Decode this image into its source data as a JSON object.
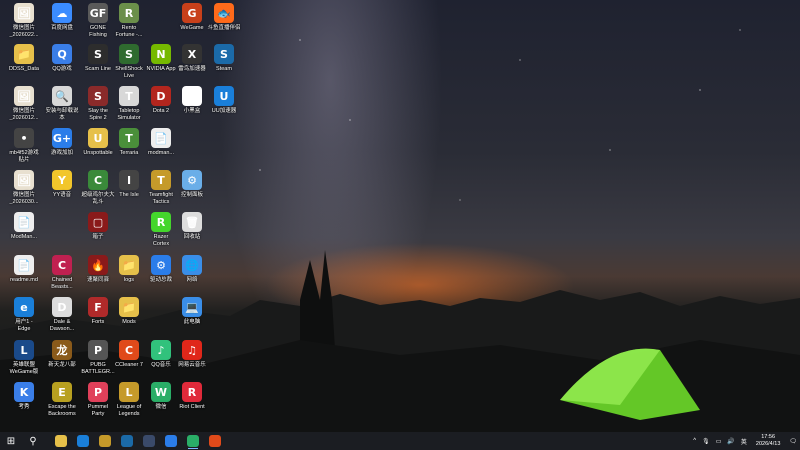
{
  "desktop": {
    "icons": [
      {
        "label": "微信图片\n_2026022...",
        "glyph": "🖼",
        "color": "#e8e0d0"
      },
      {
        "label": "百度网盘",
        "glyph": "☁",
        "color": "#3b8cff"
      },
      {
        "label": "GONE\nFishing",
        "glyph": "GF",
        "color": "#5a5a5a"
      },
      {
        "label": "Rento\nFortune -...",
        "glyph": "R",
        "color": "#6b8f4a"
      },
      {
        "label": "WeGame",
        "glyph": "G",
        "color": "#c8401a"
      },
      {
        "label": "斗鱼直播伴侣",
        "glyph": "🐟",
        "color": "#ff6a1a"
      },
      {
        "label": "DDSS_Data",
        "glyph": "📁",
        "color": "#e6c04a"
      },
      {
        "label": "QQ游戏",
        "glyph": "Q",
        "color": "#3a7ee8"
      },
      {
        "label": "Scam Line",
        "glyph": "S",
        "color": "#2d2d2d"
      },
      {
        "label": "ShellShock\nLive",
        "glyph": "S",
        "color": "#2f6b2f"
      },
      {
        "label": "NVIDIA App",
        "glyph": "N",
        "color": "#76b900"
      },
      {
        "label": "雷鸟加速器",
        "glyph": "X",
        "color": "#333"
      },
      {
        "label": "Steam",
        "glyph": "S",
        "color": "#1b6aa8"
      },
      {
        "label": "微信图片\n_2026012...",
        "glyph": "🖼",
        "color": "#e8e0d0"
      },
      {
        "label": "安装与卸载说\n本",
        "glyph": "🔍",
        "color": "#d8d8d8"
      },
      {
        "label": "Slay the\nSpire 2",
        "glyph": "S",
        "color": "#8a2a2a"
      },
      {
        "label": "Tabletop\nSimulator",
        "glyph": "T",
        "color": "#d8d8d8"
      },
      {
        "label": "Dota 2",
        "glyph": "D",
        "color": "#b3261e"
      },
      {
        "label": "小黑盒",
        "glyph": "H",
        "color": "#fff"
      },
      {
        "label": "UU加速器",
        "glyph": "U",
        "color": "#1a7fd9"
      },
      {
        "label": "mb4f52游戏\n贴片",
        "glyph": "•",
        "color": "#444"
      },
      {
        "label": "游戏加加",
        "glyph": "G+",
        "color": "#2b7de9"
      },
      {
        "label": "Unspottable",
        "glyph": "U",
        "color": "#e6c04a"
      },
      {
        "label": "Terraria",
        "glyph": "T",
        "color": "#4a8f3a"
      },
      {
        "label": "modman...",
        "glyph": "📄",
        "color": "#eee"
      },
      {
        "label": "微信图片\n_2026030...",
        "glyph": "🖼",
        "color": "#e8e0d0"
      },
      {
        "label": "YY语音",
        "glyph": "Y",
        "color": "#f2c62b"
      },
      {
        "label": "超级鸡尔夫大\n乱斗",
        "glyph": "C",
        "color": "#3a8a3a"
      },
      {
        "label": "The Isle",
        "glyph": "I",
        "color": "#444"
      },
      {
        "label": "Teamfight\nTactics",
        "glyph": "T",
        "color": "#c59a2a"
      },
      {
        "label": "控制面板",
        "glyph": "⚙",
        "color": "#6aaee8"
      },
      {
        "label": "ModMan...",
        "glyph": "📄",
        "color": "#eee"
      },
      {
        "label": "箱子",
        "glyph": "▢",
        "color": "#8a1a1a"
      },
      {
        "label": "Razer\nCortex",
        "glyph": "R",
        "color": "#44d62c"
      },
      {
        "label": "回收站",
        "glyph": "🗑",
        "color": "#ddd"
      },
      {
        "label": "readme.md",
        "glyph": "📄",
        "color": "#eee"
      },
      {
        "label": "Chained\nBeasts...",
        "glyph": "C",
        "color": "#c02050"
      },
      {
        "label": "速聚同驿",
        "glyph": "🔥",
        "color": "#8a1a1a"
      },
      {
        "label": "logs",
        "glyph": "📁",
        "color": "#e6c04a"
      },
      {
        "label": "驱动总裁",
        "glyph": "⚙",
        "color": "#2b7de9"
      },
      {
        "label": "网络",
        "glyph": "🌐",
        "color": "#3a8ee8"
      },
      {
        "label": "用户1 -\nEdge",
        "glyph": "e",
        "color": "#1a7fd9"
      },
      {
        "label": "Dale &\nDawson...",
        "glyph": "D",
        "color": "#ddd"
      },
      {
        "label": "Forts",
        "glyph": "F",
        "color": "#b02a2a"
      },
      {
        "label": "Mods",
        "glyph": "📁",
        "color": "#e6c04a"
      },
      {
        "label": "此电脑",
        "glyph": "💻",
        "color": "#3a8ee8"
      },
      {
        "label": "英雄联盟\nWeGame版",
        "glyph": "L",
        "color": "#1a4a8a"
      },
      {
        "label": "新天龙八部",
        "glyph": "龙",
        "color": "#8a5a1a"
      },
      {
        "label": "PUBG\nBATTLEGR...",
        "glyph": "P",
        "color": "#555"
      },
      {
        "label": "CCleaner 7",
        "glyph": "C",
        "color": "#e04a1a"
      },
      {
        "label": "QQ音乐",
        "glyph": "♪",
        "color": "#31c27c"
      },
      {
        "label": "网易云音乐",
        "glyph": "♫",
        "color": "#e0271a"
      },
      {
        "label": "考秀",
        "glyph": "K",
        "color": "#3a7ee8"
      },
      {
        "label": "Escape the\nBackrooms",
        "glyph": "E",
        "color": "#b8a020"
      },
      {
        "label": "Pummel\nParty",
        "glyph": "P",
        "color": "#e0405a"
      },
      {
        "label": "League of\nLegends",
        "glyph": "L",
        "color": "#c59a2a"
      },
      {
        "label": "微信",
        "glyph": "W",
        "color": "#2aae67"
      },
      {
        "label": "Riot Client",
        "glyph": "R",
        "color": "#e02a3a"
      }
    ]
  },
  "taskbar": {
    "start_glyph": "⊞",
    "search_glyph": "⚲",
    "apps": [
      {
        "name": "file-explorer",
        "color": "#e6c04a",
        "active": false
      },
      {
        "name": "edge",
        "color": "#1a7fd9",
        "active": false
      },
      {
        "name": "game",
        "color": "#c59a2a",
        "active": false
      },
      {
        "name": "steam",
        "color": "#1b6aa8",
        "active": false
      },
      {
        "name": "app",
        "color": "#3a4a6a",
        "active": false
      },
      {
        "name": "pc",
        "color": "#2b7de9",
        "active": false
      },
      {
        "name": "wechat",
        "color": "#2aae67",
        "active": true
      },
      {
        "name": "qq",
        "color": "#e04a1a",
        "active": false
      }
    ],
    "tray": {
      "chevron": "^",
      "lang": "英",
      "time": "17:56",
      "date": "2026/4/13"
    }
  }
}
